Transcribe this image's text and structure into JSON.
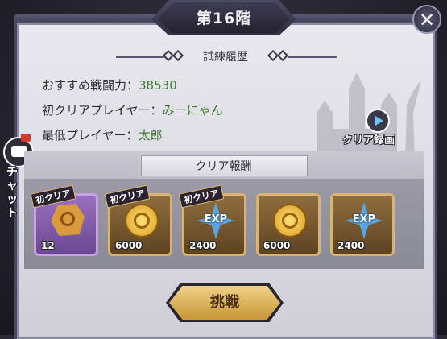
{
  "title": "第16階",
  "close_label": "✕",
  "record": {
    "section_title": "試練履歴",
    "recommended_power_label": "おすすめ戦闘力：",
    "recommended_power_value": "38530",
    "first_clear_label": "初クリアプレイヤー：",
    "first_clear_value": "みーにゃん",
    "lowest_player_label": "最低プレイヤー：",
    "lowest_player_value": "太郎"
  },
  "replay_label": "クリア録画",
  "chat_label": "チャット",
  "rewards": {
    "title": "クリア報酬",
    "items": [
      {
        "icon": "ore-icon",
        "quantity": "12",
        "first_clear_tag": "初クリア",
        "frame": "purple"
      },
      {
        "icon": "coin-icon",
        "quantity": "6000",
        "first_clear_tag": "初クリア",
        "frame": "gold"
      },
      {
        "icon": "exp-icon",
        "quantity": "2400",
        "first_clear_tag": "初クリア",
        "frame": "gold"
      },
      {
        "icon": "coin-icon",
        "quantity": "6000",
        "first_clear_tag": "",
        "frame": "gold"
      },
      {
        "icon": "exp-icon",
        "quantity": "2400",
        "first_clear_tag": "",
        "frame": "gold"
      }
    ],
    "exp_text": "EXP"
  },
  "challenge_label": "挑戦"
}
